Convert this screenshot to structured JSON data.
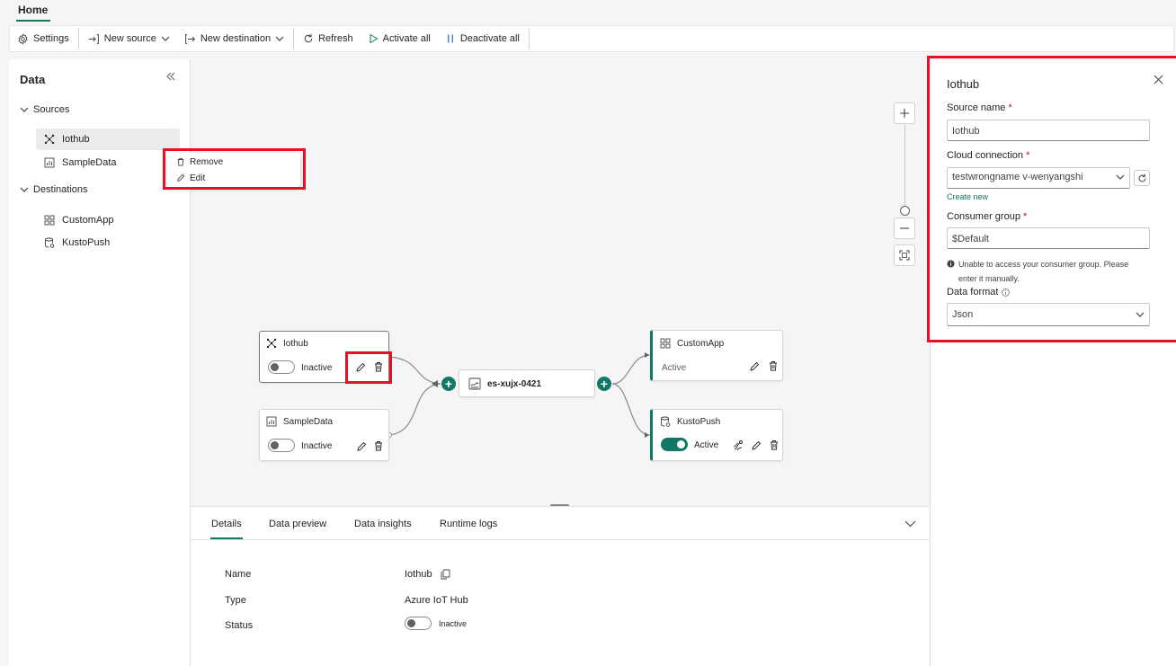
{
  "tabs": {
    "home": "Home"
  },
  "toolbar": {
    "settings": "Settings",
    "new_source": "New source",
    "new_destination": "New destination",
    "refresh": "Refresh",
    "activate_all": "Activate all",
    "deactivate_all": "Deactivate all"
  },
  "left_panel": {
    "title": "Data",
    "sources_label": "Sources",
    "sources": [
      "Iothub",
      "SampleData"
    ],
    "destinations_label": "Destinations",
    "destinations": [
      "CustomApp",
      "KustoPush"
    ]
  },
  "context_menu": {
    "remove": "Remove",
    "edit": "Edit"
  },
  "canvas": {
    "nodes": {
      "iothub": {
        "title": "Iothub",
        "status": "Inactive"
      },
      "sampledata": {
        "title": "SampleData",
        "status": "Inactive"
      },
      "stream": {
        "title": "es-xujx-0421"
      },
      "customapp": {
        "title": "CustomApp",
        "status": "Active"
      },
      "kustopush": {
        "title": "KustoPush",
        "status": "Active"
      }
    }
  },
  "bottom": {
    "tabs": [
      "Details",
      "Data preview",
      "Data insights",
      "Runtime logs"
    ],
    "details": {
      "name_label": "Name",
      "name_value": "Iothub",
      "type_label": "Type",
      "type_value": "Azure IoT Hub",
      "status_label": "Status",
      "status_value": "Inactive"
    }
  },
  "right_panel": {
    "title": "Iothub",
    "source_name_label": "Source name",
    "source_name_value": "Iothub",
    "cloud_connection_label": "Cloud connection",
    "cloud_connection_value": "testwrongname v-wenyangshi",
    "create_new": "Create new",
    "consumer_group_label": "Consumer group",
    "consumer_group_value": "$Default",
    "info_message_line1": "Unable to access your consumer group. Please",
    "info_message_line2": "enter it manually.",
    "data_format_label": "Data format",
    "data_format_value": "Json",
    "required_marker": "*"
  },
  "colors": {
    "accent": "#117865",
    "highlight_red": "#e81123"
  }
}
